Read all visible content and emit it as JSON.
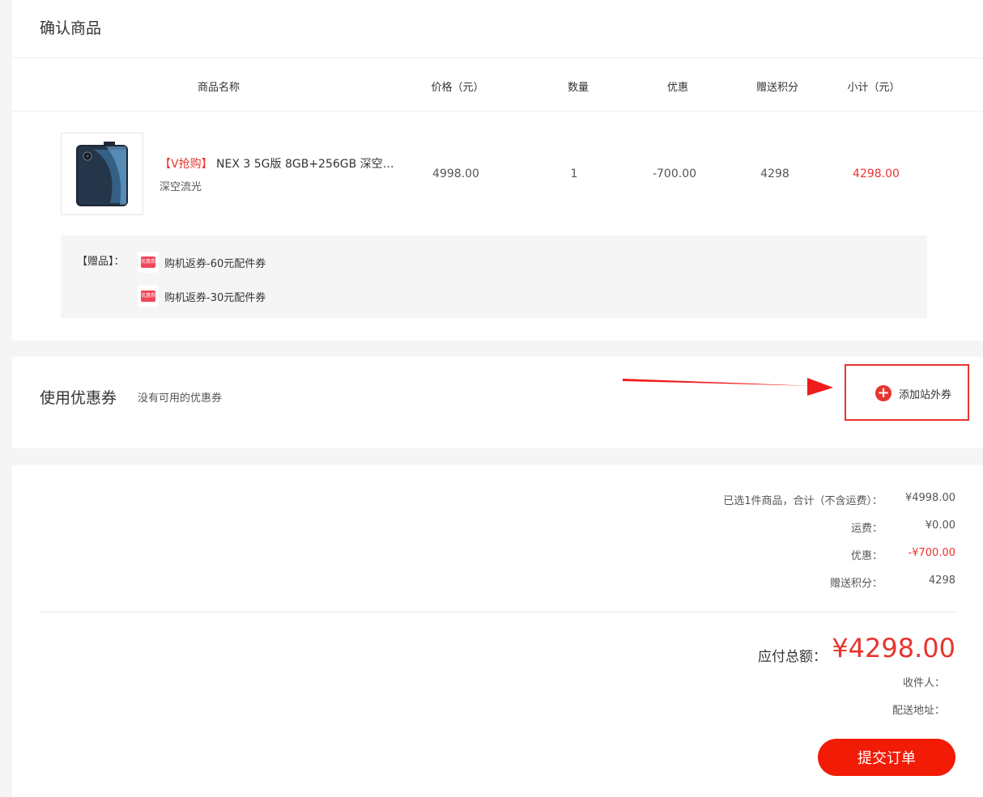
{
  "products_section": {
    "title": "确认商品",
    "columns": {
      "name": "商品名称",
      "price": "价格（元）",
      "quantity": "数量",
      "discount": "优惠",
      "points": "赠送积分",
      "subtotal": "小计（元）"
    },
    "item": {
      "tag": "【V抢购】",
      "name": "NEX 3 5G版 8GB+256GB 深空流光",
      "variant": "深空流光",
      "price": "4998.00",
      "quantity": "1",
      "discount": "-700.00",
      "points": "4298",
      "subtotal": "4298.00"
    },
    "gifts": {
      "label": "【赠品】：",
      "icon_text": "优惠券",
      "items": [
        "购机返券-60元配件券",
        "购机返券-30元配件券"
      ]
    }
  },
  "coupon_section": {
    "title": "使用优惠券",
    "status": "没有可用的优惠券",
    "add_label": "添加站外券"
  },
  "summary": {
    "rows": [
      {
        "label": "已选1件商品，合计（不含运费）：",
        "value": "¥4998.00"
      },
      {
        "label": "运费：",
        "value": "¥0.00"
      },
      {
        "label": "优惠：",
        "value": "-¥700.00"
      },
      {
        "label": "赠送积分：",
        "value": "4298"
      }
    ],
    "total_label": "应付总额：",
    "total_value": "¥4298.00",
    "receiver_label": "收件人：",
    "address_label": "配送地址：",
    "submit_label": "提交订单"
  },
  "colors": {
    "accent": "#e8352e",
    "button": "#f21b06"
  }
}
